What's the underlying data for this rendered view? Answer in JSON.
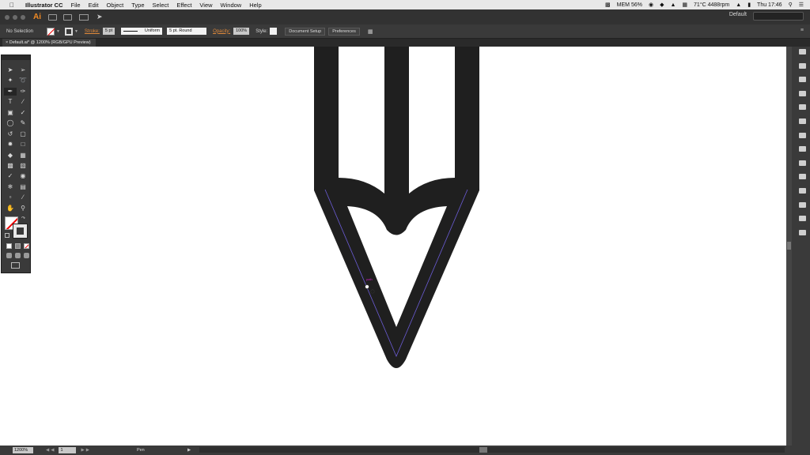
{
  "menubar": {
    "app_name": "Illustrator CC",
    "items": [
      "File",
      "Edit",
      "Object",
      "Type",
      "Select",
      "Effect",
      "View",
      "Window",
      "Help"
    ],
    "status": {
      "ram": "MEM 56%",
      "temp": "71°C 4488rpm",
      "clock": "Thu 17:46"
    }
  },
  "appbar": {
    "logo": "Ai",
    "workspace": "Default",
    "search_placeholder": ""
  },
  "control": {
    "selection": "No Selection",
    "stroke_label": "Stroke:",
    "stroke_weight": "5 pt",
    "profile": "Uniform",
    "brush": "5 pt. Round",
    "opacity_label": "Opacity:",
    "opacity": "100%",
    "style_label": "Style:",
    "doc_setup": "Document Setup",
    "preferences": "Preferences"
  },
  "document": {
    "tab_title": "Default.ai* @ 1200% (RGB/GPU Preview)",
    "close_glyph": "×"
  },
  "canvas": {
    "anchor_hint": "path"
  },
  "statusbar": {
    "zoom": "1200%",
    "page": "1",
    "tool": "Pen"
  },
  "colors": {
    "shape": "#1f1f1f",
    "path_outline": "#6b5cd6",
    "accent_orange": "#e0893a"
  },
  "tools": [
    "selection-tool",
    "direct-selection-tool",
    "magic-wand-tool",
    "lasso-tool",
    "pen-tool",
    "curvature-tool",
    "type-tool",
    "line-tool",
    "rectangle-tool",
    "paintbrush-tool",
    "shaper-tool",
    "eraser-tool",
    "rotate-tool",
    "scale-tool",
    "width-tool",
    "free-transform-tool",
    "shape-builder-tool",
    "perspective-tool",
    "mesh-tool",
    "gradient-tool",
    "eyedropper-tool",
    "blend-tool",
    "symbol-sprayer-tool",
    "column-graph-tool",
    "artboard-tool",
    "slice-tool",
    "hand-tool",
    "zoom-tool"
  ]
}
